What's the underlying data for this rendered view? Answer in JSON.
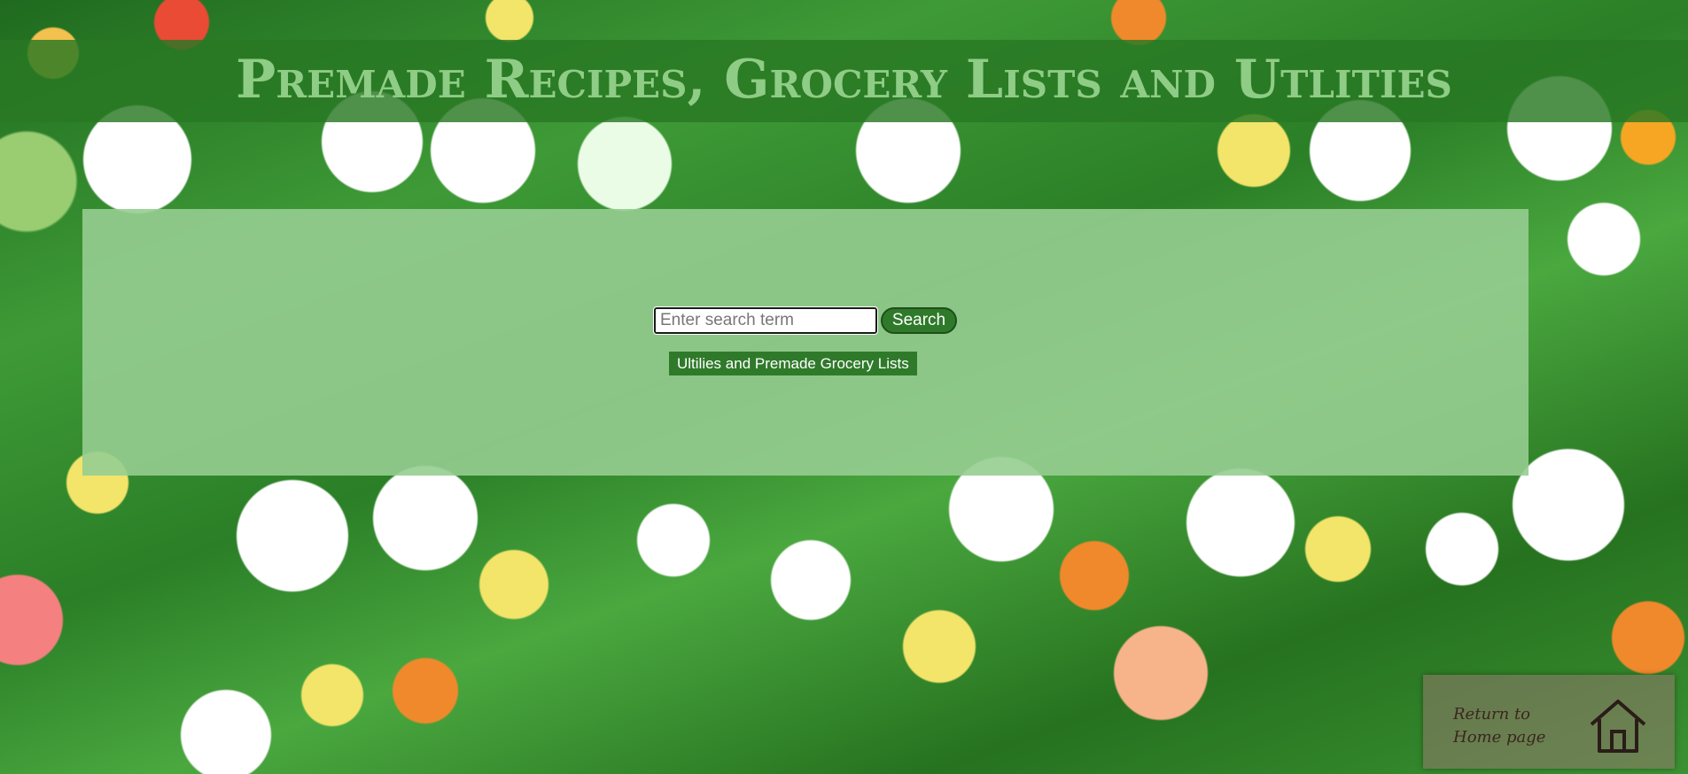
{
  "header": {
    "title": "Premade Recipes, Grocery Lists and Utlities"
  },
  "search": {
    "placeholder": "Enter search term",
    "value": "",
    "button_label": "Search"
  },
  "links": {
    "utilities_label": "Ultilies and Premade Grocery Lists"
  },
  "home": {
    "label": "Return to Home page",
    "icon": "home-icon"
  },
  "colors": {
    "accent": "#2f7a2a",
    "title_text": "#8fcc86",
    "panel": "#96cd91"
  }
}
